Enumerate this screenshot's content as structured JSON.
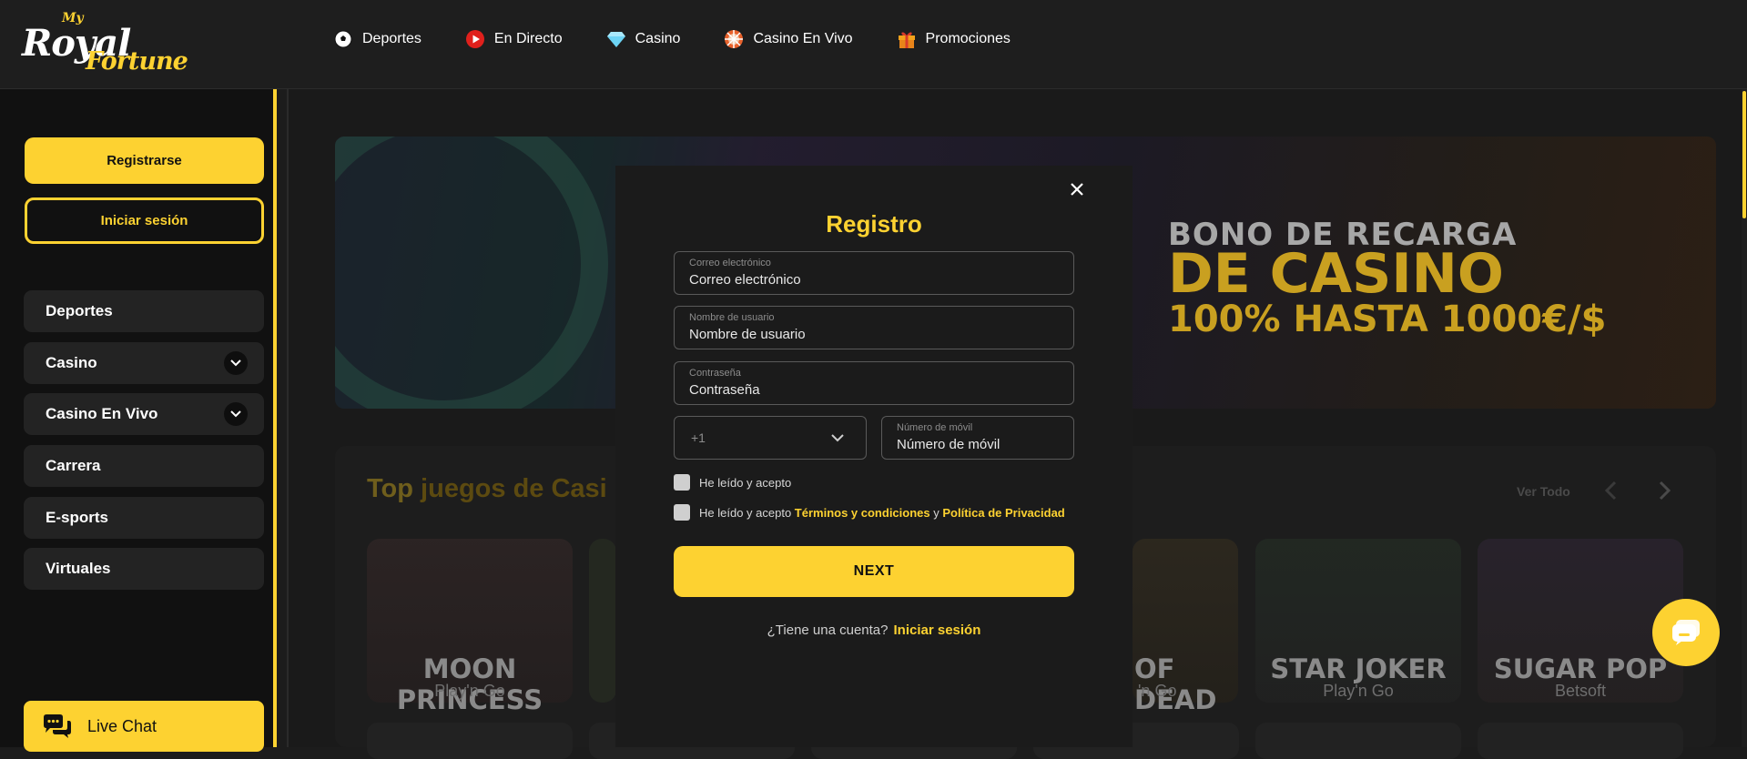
{
  "header": {
    "logo": {
      "my": "My",
      "royal": "Royal",
      "fortune": "Fortune"
    },
    "nav": [
      {
        "label": "Deportes",
        "icon": "soccer-ball-icon"
      },
      {
        "label": "En Directo",
        "icon": "live-play-icon"
      },
      {
        "label": "Casino",
        "icon": "diamond-icon"
      },
      {
        "label": "Casino En Vivo",
        "icon": "roulette-icon"
      },
      {
        "label": "Promociones",
        "icon": "gift-icon"
      }
    ]
  },
  "sidebar": {
    "register_label": "Registrarse",
    "login_label": "Iniciar sesión",
    "items": [
      {
        "label": "Deportes",
        "expandable": false
      },
      {
        "label": "Casino",
        "expandable": true
      },
      {
        "label": "Casino En Vivo",
        "expandable": true
      },
      {
        "label": "Carrera",
        "expandable": false
      },
      {
        "label": "E-sports",
        "expandable": false
      },
      {
        "label": "Virtuales",
        "expandable": false
      }
    ],
    "live_chat_label": "Live Chat"
  },
  "main": {
    "banner": {
      "line1": "BONO DE RECARGA",
      "line2": "DE CASINO",
      "line3": "100% HASTA 1000€/$"
    },
    "section": {
      "title_prefix": "Top",
      "title_rest": " juegos de Casi",
      "see_all": "Ver Todo"
    },
    "games": [
      {
        "name": "MOON PRINCESS",
        "provider": "Play'n Go"
      },
      {
        "name": "OF DEAD",
        "provider": "'n Go"
      },
      {
        "name": "STAR JOKER",
        "provider": "Play'n Go"
      },
      {
        "name": "SUGAR POP",
        "provider": "Betsoft"
      }
    ]
  },
  "modal": {
    "title": "Registro",
    "email": {
      "label": "Correo electrónico",
      "placeholder": "Correo electrónico"
    },
    "username": {
      "label": "Nombre de usuario",
      "placeholder": "Nombre de usuario"
    },
    "password": {
      "label": "Contraseña",
      "placeholder": "Contraseña"
    },
    "country_code": "+1",
    "phone": {
      "label": "Número de móvil",
      "placeholder": "Número de móvil"
    },
    "check1": "He leído y acepto",
    "check2_prefix": "He leído y acepto ",
    "check2_terms": "Términos y condiciones",
    "check2_and": " y ",
    "check2_privacy": "Política de Privacidad",
    "next_label": "NEXT",
    "have_account": "¿Tiene una cuenta?",
    "login_link": "Iniciar sesión"
  },
  "colors": {
    "accent": "#fdd231",
    "background": "#1c1c1c",
    "sidebar": "#111111"
  }
}
